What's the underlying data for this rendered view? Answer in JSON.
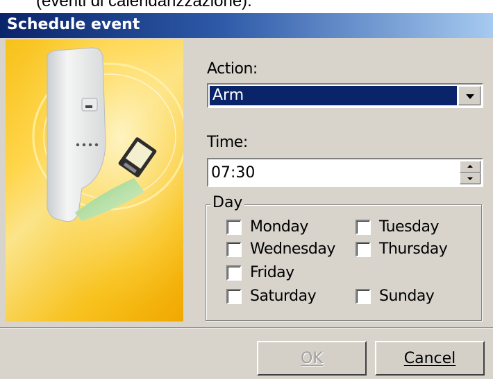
{
  "caption": "(eventi di calendarizzazione).",
  "window": {
    "title": "Schedule event"
  },
  "form": {
    "action_label": "Action:",
    "action_value": "Arm",
    "time_label": "Time:",
    "time_value": "07:30",
    "day_legend": "Day"
  },
  "days": [
    {
      "label": "Monday",
      "checked": false
    },
    {
      "label": "Tuesday",
      "checked": false
    },
    {
      "label": "Wednesday",
      "checked": false
    },
    {
      "label": "Thursday",
      "checked": false
    },
    {
      "label": "Friday",
      "checked": false
    },
    {
      "label": "Saturday",
      "checked": false
    },
    {
      "label": "Sunday",
      "checked": false
    }
  ],
  "buttons": {
    "ok": "OK",
    "cancel": "Cancel",
    "ok_enabled": false
  },
  "colors": {
    "title_bar_start": "#0a246a",
    "title_bar_end": "#a6caf0",
    "selection": "#0a246a",
    "dialog_face": "#d8d4cc",
    "banner_yellow": "#f7c11a"
  },
  "icons": {
    "banner_image": "motion-sensor-with-card-illustration",
    "combo_arrow": "chevron-down-icon",
    "spin_up": "spin-up-icon",
    "spin_down": "spin-down-icon"
  }
}
